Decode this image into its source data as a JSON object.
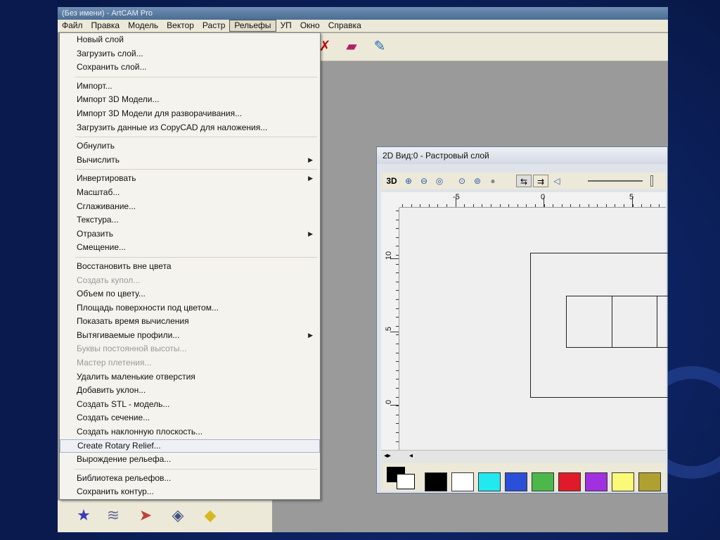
{
  "app": {
    "title": "(Без имени) - ArtCAM Pro"
  },
  "menubar": {
    "items": [
      "Файл",
      "Правка",
      "Модель",
      "Вектор",
      "Растр",
      "Рельефы",
      "УП",
      "Окно",
      "Справка"
    ],
    "active": "Рельефы"
  },
  "dropdown": {
    "groups": [
      [
        {
          "label": "Новый слой"
        },
        {
          "label": "Загрузить слой..."
        },
        {
          "label": "Сохранить слой..."
        }
      ],
      [
        {
          "label": "Импорт..."
        },
        {
          "label": "Импорт 3D Модели..."
        },
        {
          "label": "Импорт 3D Модели для разворачивания..."
        },
        {
          "label": "Загрузить данные из CopyCAD для наложения..."
        }
      ],
      [
        {
          "label": "Обнулить"
        },
        {
          "label": "Вычислить",
          "submenu": true
        }
      ],
      [
        {
          "label": "Инвертировать",
          "submenu": true
        },
        {
          "label": "Масштаб..."
        },
        {
          "label": "Сглаживание..."
        },
        {
          "label": "Текстура..."
        },
        {
          "label": "Отразить",
          "submenu": true
        },
        {
          "label": "Смещение..."
        }
      ],
      [
        {
          "label": "Восстановить вне цвета"
        },
        {
          "label": "Создать купол...",
          "disabled": true
        },
        {
          "label": "Объем по цвету..."
        },
        {
          "label": "Площадь поверхности под цветом..."
        },
        {
          "label": "Показать время вычисления"
        },
        {
          "label": "Вытягиваемые профили...",
          "submenu": true
        },
        {
          "label": "Буквы постоянной высоты...",
          "disabled": true
        },
        {
          "label": "Мастер плетения...",
          "disabled": true
        },
        {
          "label": "Удалить маленькие отверстия"
        },
        {
          "label": "Добавить уклон..."
        },
        {
          "label": "Создать STL - модель..."
        },
        {
          "label": "Создать сечение..."
        },
        {
          "label": "Создать наклонную плоскость..."
        },
        {
          "label": "Create Rotary Relief...",
          "highlighted": true
        },
        {
          "label": "Вырождение рельефа..."
        }
      ],
      [
        {
          "label": "Библиотека рельефов..."
        },
        {
          "label": "Сохранить контур..."
        }
      ]
    ]
  },
  "view_window": {
    "title": "2D Вид:0 - Растровый слой",
    "toolbar_3d": "3D",
    "ruler_h_labels": [
      "-5",
      "0",
      "5"
    ],
    "ruler_v_labels": [
      "10",
      "5",
      "0"
    ]
  },
  "palette": {
    "colors": [
      "#000000",
      "#ffffff",
      "#22e8f0",
      "#2a4fd8",
      "#4cb84c",
      "#e01a2a",
      "#a030e0",
      "#fafa78",
      "#b0a030"
    ]
  },
  "icons": {
    "toolbar": [
      "delete-icon",
      "book-icon",
      "wizard-icon"
    ],
    "left_panel": [
      "star-icon",
      "relief-icon",
      "brush-icon",
      "mesh-icon",
      "layer-icon"
    ]
  }
}
